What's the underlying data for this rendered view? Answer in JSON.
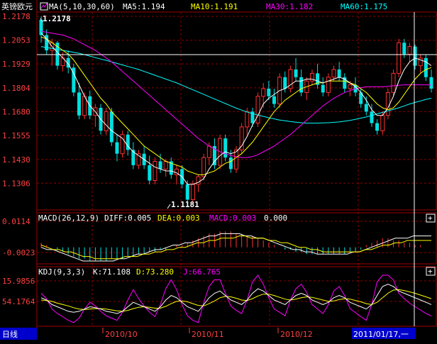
{
  "header": {
    "instrument": "英镑欧元",
    "ma_label": "MA(5,10,30,60)",
    "ma5": "MA5:1.194",
    "ma10": "MA10:1.191",
    "ma30": "MA30:1.182",
    "ma60": "MA60:1.175"
  },
  "annotations": {
    "high": "1.2178",
    "low": "1.1181"
  },
  "macd": {
    "label": "MACD(26,12,9)",
    "diff": "DIFF:0.005",
    "dea": "DEA:0.003",
    "macd": "MACD:0.003",
    "extra": "0.000",
    "ticks": [
      "0.0114",
      "-0.0023"
    ]
  },
  "kdj": {
    "label": "KDJ(9,3,3)",
    "k": "K:71.108",
    "d": "D:73.280",
    "j": "J:66.765",
    "ticks": [
      "15.9856",
      "54.1764"
    ]
  },
  "footer": {
    "period": "日线",
    "months": [
      "2010/10",
      "2010/11",
      "2010/12"
    ],
    "cursor_date": "2011/01/17,一"
  },
  "colors": {
    "up": "#ff3030",
    "down": "#00e0e0",
    "ma5": "#ffffff",
    "ma10": "#ffff00",
    "ma30": "#ff00ff",
    "ma60": "#00ffff",
    "grid": "#8b0000",
    "border": "#a00000",
    "axis_text": "#ff4040",
    "period_bg": "#0000cc",
    "cursor_bg": "#0000cc"
  },
  "chart_data": {
    "type": "candlestick",
    "price_axis": {
      "ticks": [
        1.2178,
        1.2053,
        1.1929,
        1.1804,
        1.168,
        1.1555,
        1.143,
        1.1306
      ],
      "range": [
        1.1181,
        1.2178
      ]
    },
    "candles": [
      [
        1.216,
        1.2178,
        1.204,
        1.208
      ],
      [
        1.208,
        1.211,
        1.198,
        1.2
      ],
      [
        1.2,
        1.206,
        1.192,
        1.204
      ],
      [
        1.204,
        1.205,
        1.19,
        1.192
      ],
      [
        1.192,
        1.199,
        1.189,
        1.196
      ],
      [
        1.196,
        1.2,
        1.188,
        1.191
      ],
      [
        1.191,
        1.193,
        1.176,
        1.178
      ],
      [
        1.178,
        1.183,
        1.164,
        1.166
      ],
      [
        1.166,
        1.178,
        1.164,
        1.176
      ],
      [
        1.176,
        1.179,
        1.164,
        1.166
      ],
      [
        1.166,
        1.172,
        1.16,
        1.17
      ],
      [
        1.17,
        1.172,
        1.156,
        1.158
      ],
      [
        1.158,
        1.17,
        1.156,
        1.168
      ],
      [
        1.168,
        1.17,
        1.15,
        1.152
      ],
      [
        1.152,
        1.156,
        1.142,
        1.146
      ],
      [
        1.146,
        1.158,
        1.144,
        1.156
      ],
      [
        1.156,
        1.158,
        1.145,
        1.148
      ],
      [
        1.148,
        1.152,
        1.138,
        1.14
      ],
      [
        1.14,
        1.148,
        1.138,
        1.146
      ],
      [
        1.146,
        1.15,
        1.138,
        1.14
      ],
      [
        1.14,
        1.145,
        1.13,
        1.132
      ],
      [
        1.132,
        1.144,
        1.13,
        1.142
      ],
      [
        1.142,
        1.146,
        1.136,
        1.138
      ],
      [
        1.138,
        1.143,
        1.134,
        1.142
      ],
      [
        1.142,
        1.144,
        1.133,
        1.135
      ],
      [
        1.135,
        1.14,
        1.13,
        1.138
      ],
      [
        1.138,
        1.14,
        1.128,
        1.13
      ],
      [
        1.13,
        1.132,
        1.1181,
        1.122
      ],
      [
        1.122,
        1.132,
        1.12,
        1.13
      ],
      [
        1.13,
        1.135,
        1.126,
        1.134
      ],
      [
        1.134,
        1.146,
        1.132,
        1.144
      ],
      [
        1.144,
        1.152,
        1.14,
        1.15
      ],
      [
        1.15,
        1.154,
        1.138,
        1.14
      ],
      [
        1.14,
        1.156,
        1.138,
        1.154
      ],
      [
        1.154,
        1.156,
        1.142,
        1.144
      ],
      [
        1.144,
        1.148,
        1.136,
        1.138
      ],
      [
        1.138,
        1.15,
        1.136,
        1.148
      ],
      [
        1.148,
        1.162,
        1.146,
        1.16
      ],
      [
        1.16,
        1.17,
        1.156,
        1.168
      ],
      [
        1.168,
        1.17,
        1.16,
        1.162
      ],
      [
        1.162,
        1.178,
        1.16,
        1.176
      ],
      [
        1.176,
        1.183,
        1.17,
        1.18
      ],
      [
        1.18,
        1.184,
        1.174,
        1.176
      ],
      [
        1.176,
        1.18,
        1.17,
        1.172
      ],
      [
        1.172,
        1.188,
        1.17,
        1.186
      ],
      [
        1.186,
        1.189,
        1.178,
        1.18
      ],
      [
        1.18,
        1.192,
        1.178,
        1.19
      ],
      [
        1.19,
        1.196,
        1.184,
        1.186
      ],
      [
        1.186,
        1.19,
        1.176,
        1.178
      ],
      [
        1.178,
        1.186,
        1.174,
        1.184
      ],
      [
        1.184,
        1.19,
        1.182,
        1.188
      ],
      [
        1.188,
        1.193,
        1.18,
        1.182
      ],
      [
        1.182,
        1.186,
        1.176,
        1.178
      ],
      [
        1.178,
        1.188,
        1.176,
        1.186
      ],
      [
        1.186,
        1.192,
        1.184,
        1.19
      ],
      [
        1.19,
        1.194,
        1.184,
        1.186
      ],
      [
        1.186,
        1.188,
        1.178,
        1.18
      ],
      [
        1.18,
        1.184,
        1.176,
        1.182
      ],
      [
        1.182,
        1.186,
        1.176,
        1.178
      ],
      [
        1.178,
        1.18,
        1.17,
        1.172
      ],
      [
        1.172,
        1.176,
        1.166,
        1.168
      ],
      [
        1.168,
        1.172,
        1.16,
        1.162
      ],
      [
        1.162,
        1.164,
        1.156,
        1.158
      ],
      [
        1.158,
        1.168,
        1.156,
        1.166
      ],
      [
        1.166,
        1.18,
        1.164,
        1.178
      ],
      [
        1.178,
        1.19,
        1.176,
        1.188
      ],
      [
        1.188,
        1.206,
        1.186,
        1.204
      ],
      [
        1.204,
        1.206,
        1.196,
        1.198
      ],
      [
        1.198,
        1.204,
        1.194,
        1.202
      ],
      [
        1.202,
        1.203,
        1.19,
        1.192
      ],
      [
        1.192,
        1.198,
        1.188,
        1.196
      ],
      [
        1.196,
        1.198,
        1.184,
        1.186
      ],
      [
        1.186,
        1.19,
        1.178,
        1.18
      ]
    ],
    "ma5": [
      1.209,
      1.206,
      1.202,
      1.199,
      1.196,
      1.193,
      1.188,
      1.182,
      1.176,
      1.171,
      1.168,
      1.164,
      1.161,
      1.158,
      1.156,
      1.154,
      1.15,
      1.147,
      1.145,
      1.143,
      1.141,
      1.139,
      1.138,
      1.137,
      1.137,
      1.136,
      1.134,
      1.13,
      1.13,
      1.131,
      1.133,
      1.138,
      1.142,
      1.145,
      1.147,
      1.146,
      1.147,
      1.15,
      1.155,
      1.161,
      1.166,
      1.172,
      1.175,
      1.177,
      1.179,
      1.18,
      1.182,
      1.184,
      1.184,
      1.185,
      1.185,
      1.184,
      1.183,
      1.184,
      1.185,
      1.186,
      1.185,
      1.183,
      1.181,
      1.178,
      1.174,
      1.169,
      1.166,
      1.166,
      1.17,
      1.176,
      1.184,
      1.19,
      1.194,
      1.196,
      1.195,
      1.194,
      1.192
    ],
    "ma10": [
      1.207,
      1.206,
      1.204,
      1.202,
      1.2,
      1.198,
      1.195,
      1.191,
      1.187,
      1.183,
      1.179,
      1.175,
      1.172,
      1.168,
      1.165,
      1.162,
      1.159,
      1.156,
      1.153,
      1.15,
      1.148,
      1.146,
      1.144,
      1.142,
      1.141,
      1.14,
      1.139,
      1.137,
      1.136,
      1.135,
      1.135,
      1.136,
      1.137,
      1.139,
      1.141,
      1.142,
      1.144,
      1.146,
      1.149,
      1.152,
      1.156,
      1.16,
      1.164,
      1.168,
      1.171,
      1.174,
      1.176,
      1.178,
      1.18,
      1.181,
      1.182,
      1.183,
      1.183,
      1.184,
      1.184,
      1.184,
      1.184,
      1.183,
      1.182,
      1.18,
      1.178,
      1.175,
      1.172,
      1.17,
      1.169,
      1.17,
      1.173,
      1.177,
      1.181,
      1.185,
      1.188,
      1.19,
      1.191
    ],
    "ma30": [
      1.21,
      1.2095,
      1.209,
      1.2085,
      1.208,
      1.207,
      1.206,
      1.2045,
      1.203,
      1.2015,
      1.2,
      1.198,
      1.196,
      1.194,
      1.1915,
      1.189,
      1.1865,
      1.184,
      1.1815,
      1.179,
      1.1765,
      1.174,
      1.1715,
      1.169,
      1.1665,
      1.164,
      1.1615,
      1.159,
      1.1565,
      1.154,
      1.152,
      1.15,
      1.1485,
      1.147,
      1.146,
      1.145,
      1.1445,
      1.144,
      1.144,
      1.1445,
      1.1455,
      1.147,
      1.1485,
      1.15,
      1.152,
      1.154,
      1.156,
      1.1585,
      1.161,
      1.1635,
      1.166,
      1.1685,
      1.171,
      1.173,
      1.175,
      1.1765,
      1.178,
      1.179,
      1.18,
      1.1805,
      1.181,
      1.181,
      1.181,
      1.181,
      1.1812,
      1.1815,
      1.1818,
      1.182,
      1.182,
      1.182,
      1.182,
      1.182,
      1.182
    ],
    "ma60": [
      1.202,
      1.2015,
      1.201,
      1.2005,
      1.2,
      1.1995,
      1.199,
      1.1985,
      1.1978,
      1.197,
      1.1962,
      1.1955,
      1.1948,
      1.194,
      1.1932,
      1.1924,
      1.1916,
      1.1908,
      1.19,
      1.189,
      1.188,
      1.187,
      1.186,
      1.185,
      1.184,
      1.183,
      1.1818,
      1.1806,
      1.1794,
      1.1782,
      1.177,
      1.1758,
      1.1746,
      1.1734,
      1.1722,
      1.171,
      1.1698,
      1.1688,
      1.1678,
      1.167,
      1.1662,
      1.1655,
      1.1648,
      1.1642,
      1.1636,
      1.1632,
      1.1628,
      1.1625,
      1.1622,
      1.162,
      1.162,
      1.162,
      1.1621,
      1.1622,
      1.1624,
      1.1626,
      1.163,
      1.1634,
      1.164,
      1.1646,
      1.1652,
      1.166,
      1.1668,
      1.1676,
      1.1684,
      1.1692,
      1.17,
      1.171,
      1.172,
      1.1728,
      1.1736,
      1.1744,
      1.175
    ],
    "macd_axis": {
      "range": [
        -0.006,
        0.0114
      ]
    },
    "macd_hist": [
      0.002,
      0.001,
      0.0,
      -0.001,
      -0.002,
      -0.003,
      -0.004,
      -0.005,
      -0.005,
      -0.006,
      -0.006,
      -0.006,
      -0.006,
      -0.005,
      -0.005,
      -0.005,
      -0.004,
      -0.004,
      -0.003,
      -0.003,
      -0.002,
      -0.002,
      -0.001,
      -0.001,
      0.0,
      0.001,
      0.001,
      0.002,
      0.003,
      0.004,
      0.005,
      0.006,
      0.006,
      0.007,
      0.007,
      0.007,
      0.006,
      0.006,
      0.005,
      0.005,
      0.004,
      0.003,
      0.002,
      0.001,
      0.0,
      -0.001,
      -0.001,
      -0.002,
      -0.002,
      -0.003,
      -0.003,
      -0.003,
      -0.003,
      -0.003,
      -0.003,
      -0.003,
      -0.003,
      -0.002,
      -0.002,
      -0.001,
      0.001,
      0.002,
      0.003,
      0.004,
      0.004,
      0.003,
      0.003,
      0.002,
      0.002,
      0.001,
      0.001,
      0.0,
      0.0
    ],
    "diff_line": [
      0.0,
      -0.001,
      -0.001,
      -0.002,
      -0.003,
      -0.004,
      -0.005,
      -0.006,
      -0.006,
      -0.006,
      -0.006,
      -0.006,
      -0.006,
      -0.005,
      -0.005,
      -0.004,
      -0.003,
      -0.003,
      -0.002,
      -0.001,
      -0.001,
      0.0,
      0.001,
      0.001,
      0.002,
      0.002,
      0.003,
      0.004,
      0.005,
      0.005,
      0.006,
      0.006,
      0.006,
      0.006,
      0.005,
      0.005,
      0.004,
      0.004,
      0.003,
      0.002,
      0.001,
      0.0,
      -0.001,
      -0.001,
      -0.002,
      -0.002,
      -0.003,
      -0.003,
      -0.003,
      -0.003,
      -0.003,
      -0.003,
      -0.002,
      -0.002,
      -0.001,
      0.0,
      0.001,
      0.002,
      0.003,
      0.004,
      0.004,
      0.004,
      0.005,
      0.005,
      0.005,
      0.005
    ],
    "dea_line": [
      0.001,
      0.0,
      -0.001,
      -0.001,
      -0.002,
      -0.002,
      -0.003,
      -0.004,
      -0.004,
      -0.005,
      -0.005,
      -0.005,
      -0.005,
      -0.005,
      -0.004,
      -0.004,
      -0.004,
      -0.003,
      -0.003,
      -0.002,
      -0.002,
      -0.001,
      -0.001,
      0.0,
      0.0,
      0.001,
      0.002,
      0.002,
      0.003,
      0.003,
      0.004,
      0.004,
      0.004,
      0.005,
      0.005,
      0.004,
      0.004,
      0.004,
      0.003,
      0.003,
      0.002,
      0.002,
      0.001,
      0.0,
      0.0,
      -0.001,
      -0.001,
      -0.002,
      -0.002,
      -0.002,
      -0.002,
      -0.002,
      -0.002,
      -0.002,
      -0.001,
      -0.001,
      0.0,
      0.001,
      0.001,
      0.002,
      0.002,
      0.003,
      0.003,
      0.003,
      0.003,
      0.003
    ],
    "kdj_axis": {
      "range": [
        0,
        110
      ]
    },
    "kdj_k": [
      60,
      55,
      45,
      40,
      35,
      30,
      28,
      30,
      35,
      40,
      38,
      35,
      30,
      28,
      25,
      30,
      40,
      50,
      45,
      40,
      35,
      30,
      40,
      55,
      65,
      60,
      50,
      40,
      35,
      30,
      45,
      60,
      70,
      75,
      65,
      55,
      50,
      45,
      55,
      70,
      80,
      75,
      65,
      55,
      50,
      45,
      55,
      65,
      70,
      65,
      55,
      50,
      45,
      50,
      60,
      65,
      60,
      50,
      45,
      40,
      35,
      45,
      65,
      85,
      90,
      85,
      75,
      70,
      65,
      60,
      55,
      50,
      45
    ],
    "kdj_d": [
      55,
      54,
      52,
      48,
      45,
      42,
      38,
      35,
      34,
      35,
      36,
      36,
      35,
      33,
      31,
      30,
      32,
      36,
      39,
      40,
      39,
      37,
      37,
      41,
      47,
      52,
      53,
      51,
      47,
      43,
      42,
      47,
      53,
      60,
      63,
      62,
      59,
      55,
      54,
      58,
      64,
      68,
      68,
      65,
      61,
      57,
      55,
      57,
      60,
      62,
      61,
      58,
      55,
      52,
      53,
      56,
      58,
      57,
      54,
      51,
      47,
      45,
      50,
      60,
      70,
      77,
      78,
      76,
      73,
      70,
      66,
      62,
      58
    ],
    "kdj_j": [
      70,
      58,
      35,
      25,
      18,
      10,
      5,
      15,
      35,
      50,
      42,
      30,
      20,
      15,
      10,
      28,
      55,
      78,
      58,
      42,
      28,
      18,
      45,
      80,
      100,
      78,
      45,
      20,
      10,
      5,
      50,
      85,
      100,
      100,
      70,
      42,
      32,
      25,
      55,
      95,
      110,
      90,
      60,
      35,
      28,
      20,
      55,
      80,
      90,
      72,
      45,
      35,
      25,
      45,
      75,
      85,
      65,
      36,
      27,
      18,
      10,
      45,
      95,
      110,
      110,
      100,
      70,
      58,
      48,
      40,
      33,
      25,
      20
    ]
  }
}
